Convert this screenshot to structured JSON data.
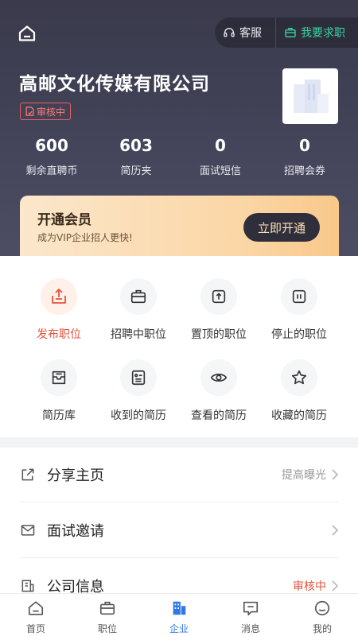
{
  "header": {
    "service_label": "客服",
    "job_seek_label": "我要求职",
    "company_name": "高邮文化传媒有限公司",
    "status_tag": "审核中"
  },
  "stats": [
    {
      "value": "600",
      "label": "剩余直聘币"
    },
    {
      "value": "603",
      "label": "简历夹"
    },
    {
      "value": "0",
      "label": "面试短信"
    },
    {
      "value": "0",
      "label": "招聘会券"
    }
  ],
  "vip": {
    "title": "开通会员",
    "subtitle": "成为VIP企业招人更快!",
    "button": "立即开通"
  },
  "grid": [
    {
      "label": "发布职位",
      "icon": "publish-icon"
    },
    {
      "label": "招聘中职位",
      "icon": "briefcase-icon"
    },
    {
      "label": "置顶的职位",
      "icon": "pin-top-icon"
    },
    {
      "label": "停止的职位",
      "icon": "pause-icon"
    },
    {
      "label": "简历库",
      "icon": "inbox-icon"
    },
    {
      "label": "收到的简历",
      "icon": "resume-icon"
    },
    {
      "label": "查看的简历",
      "icon": "eye-icon"
    },
    {
      "label": "收藏的简历",
      "icon": "star-icon"
    }
  ],
  "list": [
    {
      "label": "分享主页",
      "right": "提高曝光",
      "icon": "share-icon"
    },
    {
      "label": "面试邀请",
      "right": "",
      "icon": "mail-icon"
    },
    {
      "label": "公司信息",
      "right": "审核中",
      "icon": "company-info-icon"
    }
  ],
  "nav": [
    {
      "label": "首页",
      "icon": "home-icon"
    },
    {
      "label": "职位",
      "icon": "briefcase-icon"
    },
    {
      "label": "企业",
      "icon": "building-icon"
    },
    {
      "label": "消息",
      "icon": "message-icon"
    },
    {
      "label": "我的",
      "icon": "profile-icon"
    }
  ],
  "colors": {
    "accent_blue": "#2f78e6",
    "accent_green": "#35d6a0",
    "accent_red": "#e5533e",
    "header_bg": "#3f3f52"
  }
}
